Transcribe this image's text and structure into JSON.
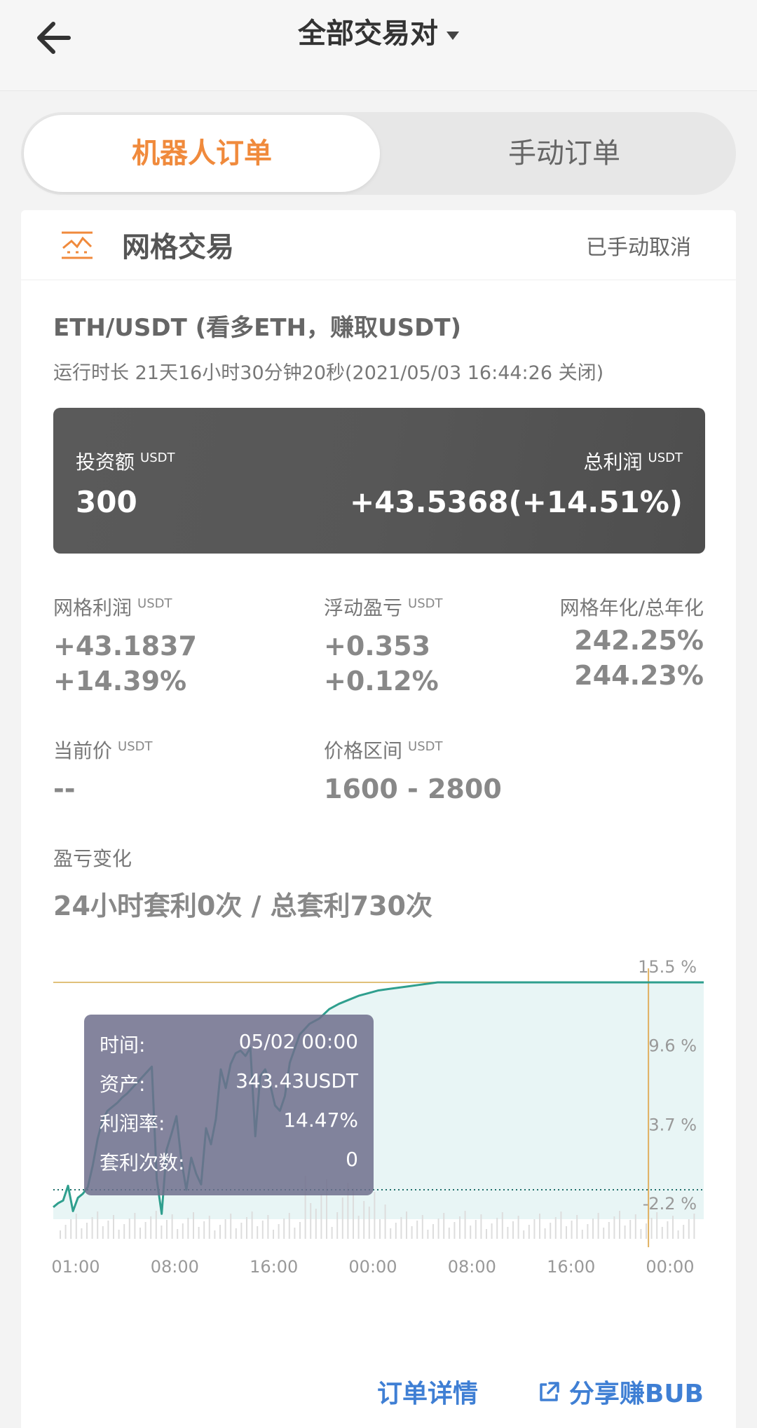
{
  "header": {
    "title": "全部交易对"
  },
  "tabs": [
    {
      "label": "机器人订单",
      "active": true
    },
    {
      "label": "手动订单",
      "active": false
    }
  ],
  "card": {
    "strategy": "网格交易",
    "status": "已手动取消",
    "pair": "ETH/USDT (看多ETH，赚取USDT)",
    "runtime": "运行时长 21天16小时30分钟20秒(2021/05/03 16:44:26 关闭)"
  },
  "summary": {
    "invest_label": "投资额",
    "invest_unit": "USDT",
    "invest_value": "300",
    "profit_label": "总利润",
    "profit_unit": "USDT",
    "profit_value": "+43.5368(+14.51%)"
  },
  "stats": {
    "grid_profit": {
      "label": "网格利润",
      "unit": "USDT",
      "value": "+43.1837",
      "pct": "+14.39%"
    },
    "floating": {
      "label": "浮动盈亏",
      "unit": "USDT",
      "value": "+0.353",
      "pct": "+0.12%"
    },
    "annual": {
      "label": "网格年化/总年化",
      "grid": "242.25%",
      "total": "244.23%"
    },
    "current_price": {
      "label": "当前价",
      "unit": "USDT",
      "value": "--"
    },
    "price_range": {
      "label": "价格区间",
      "unit": "USDT",
      "value": "1600 - 2800"
    }
  },
  "pl": {
    "label": "盈亏变化",
    "arbitrage": "24小时套利0次 / 总套利730次"
  },
  "tooltip": {
    "time_label": "时间:",
    "time_value": "05/02 00:00",
    "asset_label": "资产:",
    "asset_value": "343.43USDT",
    "rate_label": "利润率:",
    "rate_value": "14.47%",
    "count_label": "套利次数:",
    "count_value": "0"
  },
  "chart_data": {
    "type": "line",
    "x": [
      0,
      0.5,
      1,
      1.5,
      2,
      2.5,
      3,
      3.5,
      4,
      4.5,
      5,
      5.5,
      6,
      6.5,
      7,
      7.5,
      8,
      8.5,
      9,
      9.5,
      10,
      10.5,
      11,
      11.5,
      12,
      12.5,
      13,
      13.5,
      14,
      14.5,
      15,
      15.5,
      16,
      16.5,
      17,
      17.5,
      18,
      18.5,
      19,
      19.5,
      20,
      20.5,
      21,
      21.5,
      22,
      22.5,
      23,
      23.5,
      24,
      25,
      26,
      27,
      28,
      29,
      30,
      31,
      32,
      33,
      34,
      35,
      36,
      37,
      38,
      39,
      40,
      41,
      42,
      43,
      44,
      45,
      46,
      47,
      48,
      49,
      50,
      51,
      52,
      53,
      54,
      55,
      56,
      57,
      58,
      59,
      60,
      61,
      62,
      63,
      64,
      65,
      66
    ],
    "values": [
      -1.3,
      -1.0,
      -0.8,
      0.3,
      -1.6,
      -0.6,
      -0.3,
      0.2,
      1.8,
      3.8,
      5.2,
      5.9,
      6.2,
      6.5,
      6.9,
      7.2,
      7.6,
      8.0,
      8.4,
      8.8,
      9.2,
      0.8,
      -1.8,
      3.0,
      4.2,
      5.5,
      2.2,
      0.0,
      2.4,
      1.2,
      0.4,
      4.6,
      3.4,
      5.3,
      9.0,
      7.6,
      9.4,
      10.2,
      10.4,
      10.0,
      10.6,
      4.0,
      8.5,
      9.0,
      7.9,
      6.3,
      5.9,
      7.0,
      9.5,
      11.6,
      12.4,
      12.8,
      13.5,
      13.9,
      14.2,
      14.5,
      14.7,
      14.9,
      15.0,
      15.1,
      15.2,
      15.3,
      15.4,
      15.5,
      15.5,
      15.5,
      15.5,
      15.5,
      15.5,
      15.5,
      15.5,
      15.5,
      15.5,
      15.5,
      15.5,
      15.5,
      15.5,
      15.5,
      15.5,
      15.5,
      15.5,
      15.5,
      15.5,
      15.5,
      15.5,
      15.5,
      15.5,
      15.5,
      15.5,
      15.5,
      15.5
    ],
    "x_ticks": [
      "01:00",
      "08:00",
      "16:00",
      "00:00",
      "08:00",
      "16:00",
      "00:00"
    ],
    "y_ticks": [
      "15.5 %",
      "9.6 %",
      "3.7 %",
      "-2.2 %"
    ],
    "ylim": [
      -2.2,
      15.5
    ],
    "colors": {
      "line": "#2f9f8e",
      "fill": "#e8f5f5",
      "max_line": "#e0c07a",
      "cursor": "#e0b060",
      "zero_line": "#1f6f6a"
    }
  },
  "footer": {
    "order_detail": "订单详情",
    "share": "分享赚BUB"
  }
}
